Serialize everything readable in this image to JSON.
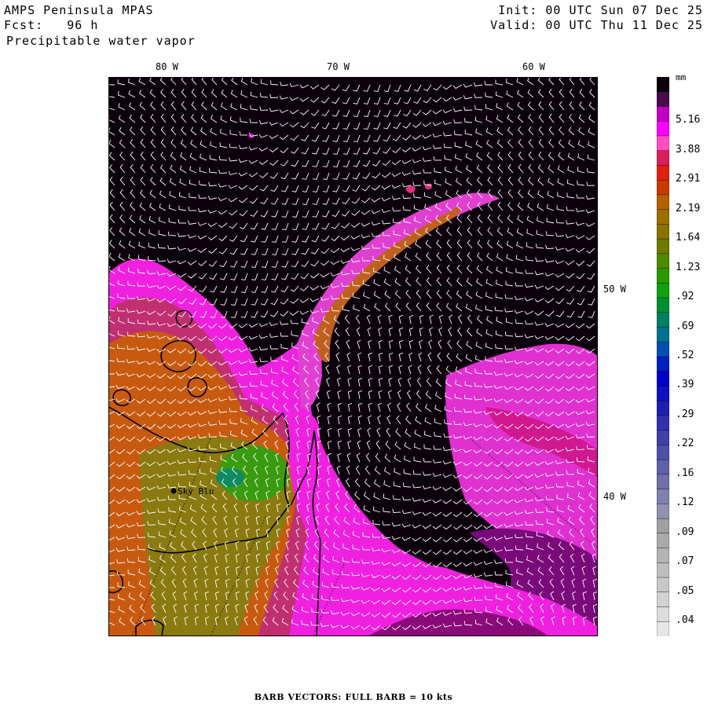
{
  "header": {
    "model": "AMPS Peninsula MPAS",
    "forecast": "Fcst:   96 h",
    "field": "Precipitable water vapor",
    "init": "Init: 00 UTC Sun 07 Dec 25",
    "valid": "Valid: 00 UTC Thu 11 Dec 25"
  },
  "lon_labels": [
    "80 W",
    "70 W",
    "60 W"
  ],
  "lat_labels": [
    "50 W",
    "40 W"
  ],
  "station": {
    "name": "Sky Blu"
  },
  "colorbar": {
    "unit": "mm",
    "labels": [
      "5.16",
      "3.88",
      "2.91",
      "2.19",
      "1.64",
      "1.23",
      ".92",
      ".69",
      ".52",
      ".39",
      ".29",
      ".22",
      ".16",
      ".12",
      ".09",
      ".07",
      ".05",
      ".04"
    ],
    "colors": [
      "#0d000d",
      "#4a0a4a",
      "#c000c0",
      "#ff00ff",
      "#ff4fbf",
      "#d8205a",
      "#e02010",
      "#c83a00",
      "#b46000",
      "#9e6e00",
      "#8a7200",
      "#6e7a00",
      "#4e8a00",
      "#2a9a00",
      "#10a010",
      "#009030",
      "#008060",
      "#007090",
      "#0050b0",
      "#0020c0",
      "#0000c8",
      "#1010c0",
      "#2020b0",
      "#3030b0",
      "#4040a8",
      "#5050a8",
      "#6060a8",
      "#7070a8",
      "#8080b0",
      "#9090b0",
      "#a0a0a0",
      "#aaaaaa",
      "#b4b4b4",
      "#bebebe",
      "#c8c8c8",
      "#d2d2d2",
      "#dcdcdc",
      "#e6e6e6"
    ]
  },
  "footer": "BARB VECTORS:  FULL BARB = 10 kts"
}
